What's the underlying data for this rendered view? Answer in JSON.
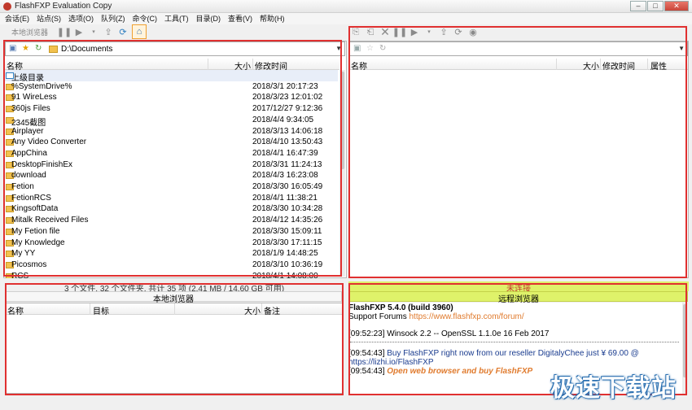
{
  "window": {
    "title": "FlashFXP Evaluation Copy"
  },
  "menu": [
    "会话(E)",
    "站点(S)",
    "选项(O)",
    "队列(Z)",
    "命令(C)",
    "工具(T)",
    "目录(D)",
    "查看(V)",
    "帮助(H)"
  ],
  "toolbar_left": {
    "local_browser_label": "本地浏览器"
  },
  "local": {
    "path": "D:\\Documents",
    "columns": {
      "name": "名称",
      "size": "大小",
      "modified": "修改时间"
    },
    "parent_dir": "上级目录",
    "files": [
      {
        "name": "%SystemDrive%",
        "modified": "2018/3/1 20:17:23"
      },
      {
        "name": "91 WireLess",
        "modified": "2018/3/23 12:01:02"
      },
      {
        "name": "360js Files",
        "modified": "2017/12/27 9:12:36"
      },
      {
        "name": "2345截图",
        "modified": "2018/4/4 9:34:05"
      },
      {
        "name": "Airplayer",
        "modified": "2018/3/13 14:06:18"
      },
      {
        "name": "Any Video Converter",
        "modified": "2018/4/10 13:50:43"
      },
      {
        "name": "AppChina",
        "modified": "2018/4/1 16:47:39"
      },
      {
        "name": "DesktopFinishEx",
        "modified": "2018/3/31 11:24:13"
      },
      {
        "name": "download",
        "modified": "2018/4/3 16:23:08"
      },
      {
        "name": "Fetion",
        "modified": "2018/3/30 16:05:49"
      },
      {
        "name": "FetionRCS",
        "modified": "2018/4/1 11:38:21"
      },
      {
        "name": "KingsoftData",
        "modified": "2018/3/30 10:34:28"
      },
      {
        "name": "Mitalk Received Files",
        "modified": "2018/4/12 14:35:26"
      },
      {
        "name": "My Fetion file",
        "modified": "2018/3/30 15:09:11"
      },
      {
        "name": "My Knowledge",
        "modified": "2018/3/30 17:11:15"
      },
      {
        "name": "My YY",
        "modified": "2018/1/9 14:48:25"
      },
      {
        "name": "Picosmos",
        "modified": "2018/3/10 10:36:19"
      },
      {
        "name": "RCS",
        "modified": "2018/4/1 14:08:00"
      }
    ],
    "status": "3 个文件, 32 个文件夹, 共计 35 项 (2.41 MB / 14.60 GB 可用)",
    "browser_label": "本地浏览器"
  },
  "remote": {
    "columns": {
      "name": "名称",
      "size": "大小",
      "modified": "修改时间",
      "attributes": "属性"
    },
    "status": "未连接",
    "browser_label": "远程浏览器"
  },
  "queue": {
    "columns": {
      "name": "名称",
      "target": "目标",
      "size": "大小",
      "note": "备注"
    }
  },
  "log": {
    "version": "FlashFXP 5.4.0 (build 3960)",
    "support_label": "Support Forums",
    "support_url": "https://www.flashfxp.com/forum/",
    "line1_time": "[09:52:23]",
    "line1_text": "Winsock 2.2 -- OpenSSL 1.1.0e  16 Feb 2017",
    "line2_time": "[09:54:43]",
    "line2_text": "Buy FlashFXP right now from our reseller DigitalyChee just ¥ 69.00 @",
    "line2_url": "https://lizhi.io/FlashFXP",
    "line3_time": "[09:54:43]",
    "line3_text": "Open web browser and buy FlashFXP"
  },
  "watermark": "极速下载站",
  "colors": {
    "highlight": "#e03030",
    "status_bar": "#dff26a",
    "link": "#e07b2e"
  }
}
